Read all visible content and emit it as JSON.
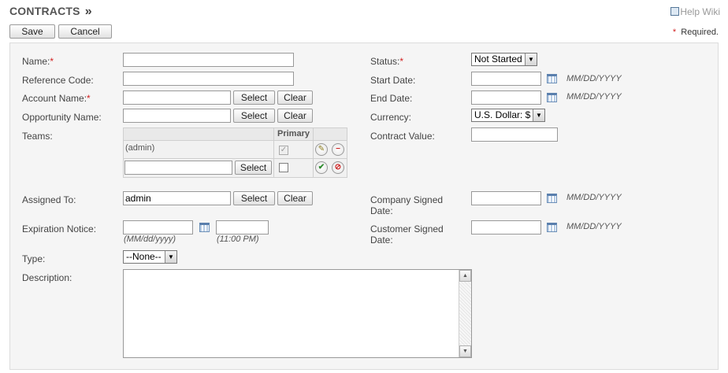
{
  "header": {
    "title": "CONTRACTS",
    "chevron": "»",
    "help_icon_glyph": "?",
    "help_label": "Help Wiki"
  },
  "toolbar": {
    "save_label": "Save",
    "cancel_label": "Cancel",
    "required_star": "*",
    "required_note": "Required."
  },
  "form": {
    "name": {
      "label": "Name:",
      "value": ""
    },
    "reference_code": {
      "label": "Reference Code:",
      "value": ""
    },
    "account_name": {
      "label": "Account Name:",
      "value": ""
    },
    "opportunity_name": {
      "label": "Opportunity Name:",
      "value": ""
    },
    "teams": {
      "label": "Teams:",
      "primary_header": "Primary",
      "rows": [
        {
          "name": "(admin)",
          "primary": true
        }
      ],
      "new_team_value": ""
    },
    "assigned_to": {
      "label": "Assigned To:",
      "value": "admin"
    },
    "expiration_notice": {
      "label": "Expiration Notice:",
      "date_hint": "(MM/dd/yyyy)",
      "time_hint": "(11:00 PM)"
    },
    "type": {
      "label": "Type:",
      "selected": "--None--"
    },
    "description": {
      "label": "Description:",
      "value": ""
    },
    "status": {
      "label": "Status:",
      "selected": "Not Started"
    },
    "start_date": {
      "label": "Start Date:",
      "format": "MM/DD/YYYY"
    },
    "end_date": {
      "label": "End Date:",
      "format": "MM/DD/YYYY"
    },
    "currency": {
      "label": "Currency:",
      "selected": "U.S. Dollar: $"
    },
    "contract_value": {
      "label": "Contract Value:",
      "value": ""
    },
    "company_signed_date": {
      "label_line1": "Company Signed",
      "label_line2": "Date:",
      "format": "MM/DD/YYYY"
    },
    "customer_signed_date": {
      "label_line1": "Customer Signed",
      "label_line2": "Date:",
      "format": "MM/DD/YYYY"
    }
  },
  "buttons": {
    "select_label": "Select",
    "clear_label": "Clear"
  },
  "icons": {
    "check_glyph": "✓",
    "pencil_glyph": "✎",
    "remove_glyph": "−",
    "accept_glyph": "✔",
    "cancel_glyph": "⊘",
    "dropdown_arrow": "▼",
    "scroll_up": "▲",
    "scroll_down": "▼"
  },
  "colors": {
    "required": "#d21f1f",
    "panel_bg": "#f5f5f5",
    "accept_green": "#2e8b2e",
    "cancel_red": "#cc2222"
  }
}
